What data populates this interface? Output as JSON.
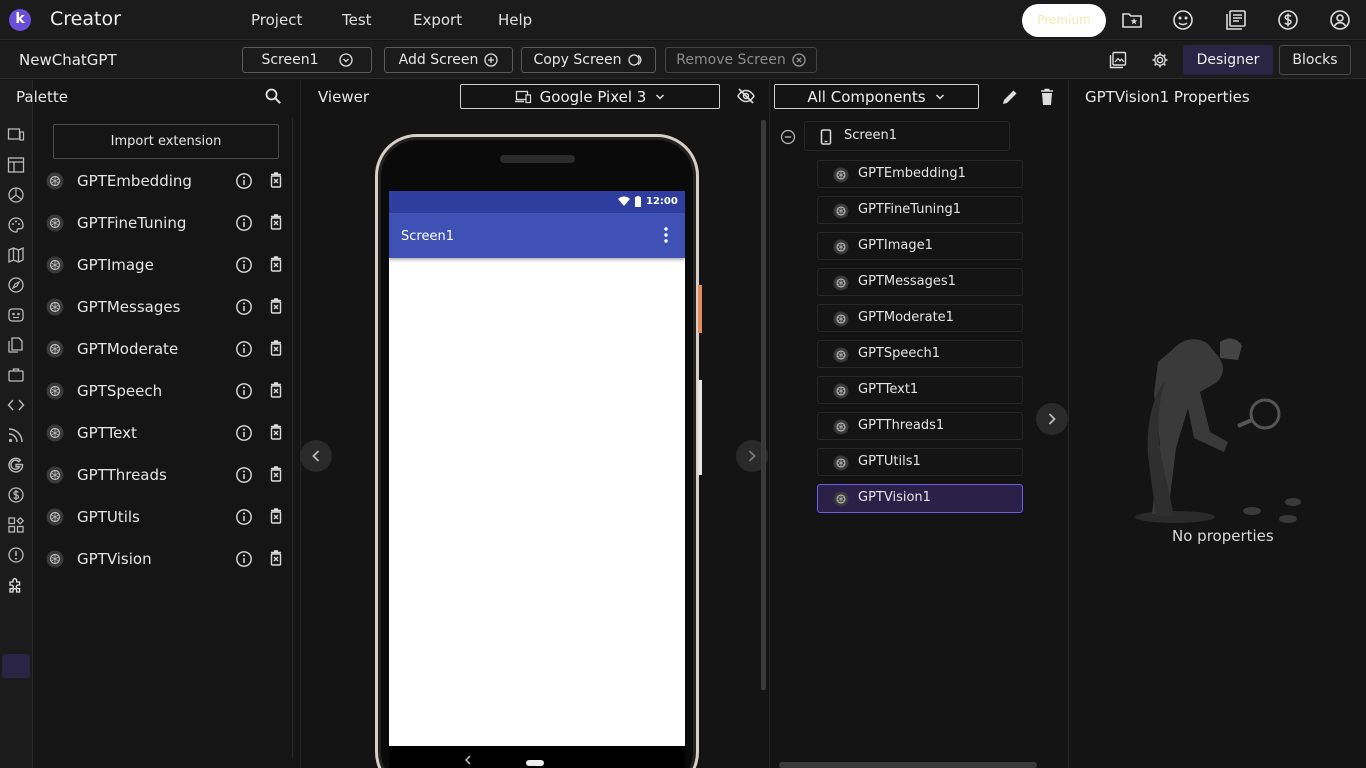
{
  "app": {
    "logo_letter": "k",
    "brand": "Creator"
  },
  "menu": {
    "project": "Project",
    "test": "Test",
    "export": "Export",
    "help": "Help"
  },
  "premium_label": "Premium",
  "project_name": "NewChatGPT",
  "screen_bar": {
    "screen_select": "Screen1",
    "add_screen": "Add Screen",
    "copy_screen": "Copy Screen",
    "remove_screen": "Remove Screen"
  },
  "modes": {
    "designer": "Designer",
    "blocks": "Blocks"
  },
  "palette": {
    "title": "Palette",
    "import_label": "Import extension",
    "items": [
      "GPTEmbedding",
      "GPTFineTuning",
      "GPTImage",
      "GPTMessages",
      "GPTModerate",
      "GPTSpeech",
      "GPTText",
      "GPTThreads",
      "GPTUtils",
      "GPTVision"
    ]
  },
  "viewer": {
    "title": "Viewer",
    "device": "Google Pixel 3",
    "status_time": "12:00",
    "screen_title": "Screen1"
  },
  "components": {
    "filter": "All Components",
    "root": "Screen1",
    "items": [
      "GPTEmbedding1",
      "GPTFineTuning1",
      "GPTImage1",
      "GPTMessages1",
      "GPTModerate1",
      "GPTSpeech1",
      "GPTText1",
      "GPTThreads1",
      "GPTUtils1",
      "GPTVision1"
    ],
    "selected": "GPTVision1"
  },
  "properties": {
    "title": "GPTVision1 Properties",
    "empty_text": "No properties"
  },
  "colors": {
    "accent": "#6c5ce7",
    "appbar": "#3f51b5",
    "statusbar": "#2f3e9e",
    "side_button": "#e38c5a"
  }
}
